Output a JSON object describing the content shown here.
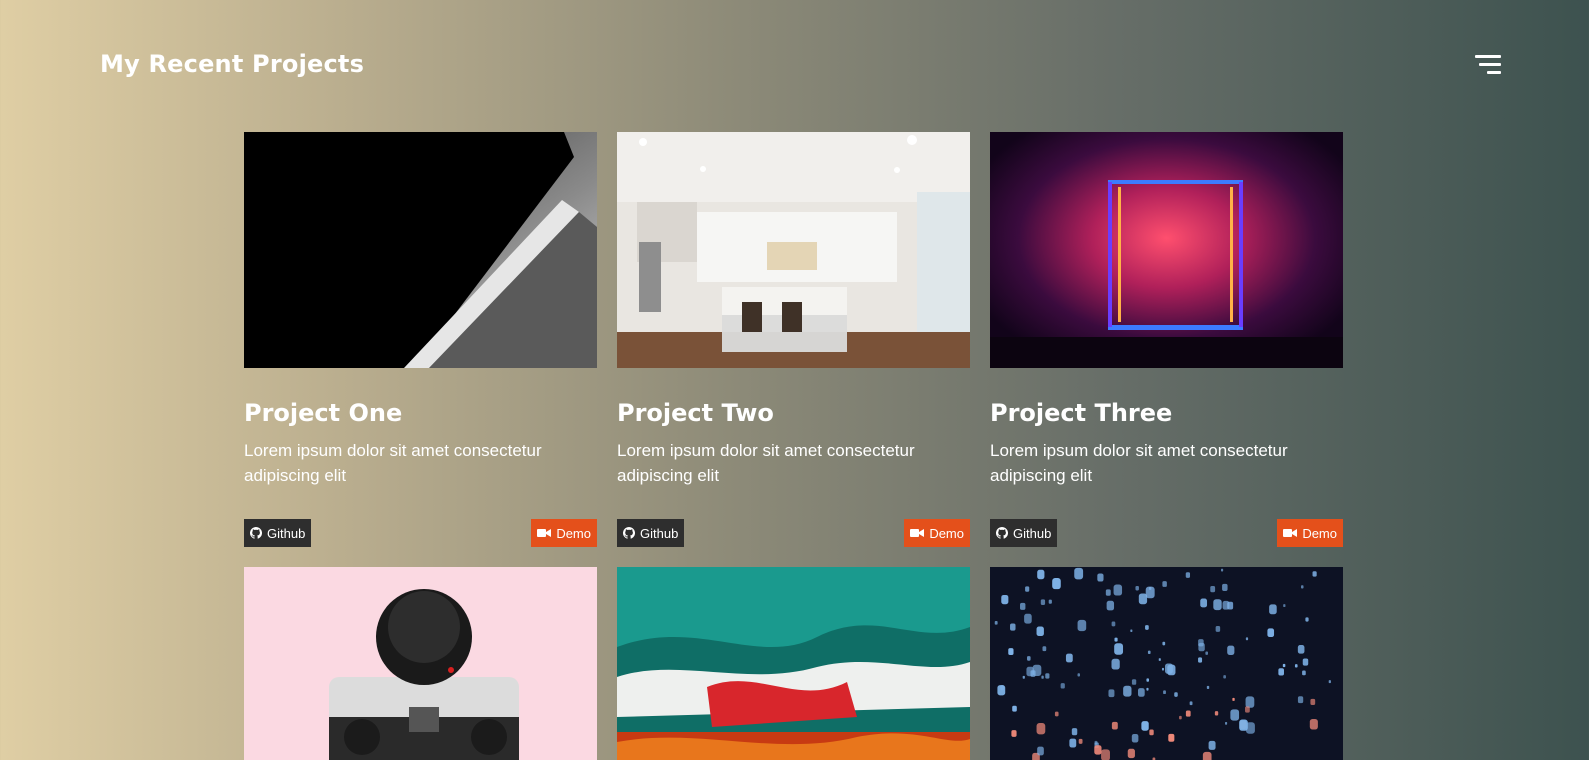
{
  "header": {
    "title": "My Recent Projects",
    "menu_icon": "hamburger-menu-icon"
  },
  "colors": {
    "background_start": "#dfcea4",
    "background_end": "#3d524f",
    "github_button": "#2e2e2e",
    "demo_button": "#e4501b",
    "text": "#ffffff"
  },
  "projects": [
    {
      "title": "Project One",
      "description": "Lorem ipsum dolor sit amet consectetur adipiscing elit",
      "image": "black-white-abstract-photo",
      "github_label": "Github",
      "demo_label": "Demo"
    },
    {
      "title": "Project Two",
      "description": "Lorem ipsum dolor sit amet consectetur adipiscing elit",
      "image": "white-kitchen-photo",
      "github_label": "Github",
      "demo_label": "Demo"
    },
    {
      "title": "Project Three",
      "description": "Lorem ipsum dolor sit amet consectetur adipiscing elit",
      "image": "neon-frame-photo",
      "github_label": "Github",
      "demo_label": "Demo"
    },
    {
      "image": "camera-pink-background-photo"
    },
    {
      "image": "abstract-paint-photo"
    },
    {
      "image": "lantern-installation-photo"
    }
  ]
}
